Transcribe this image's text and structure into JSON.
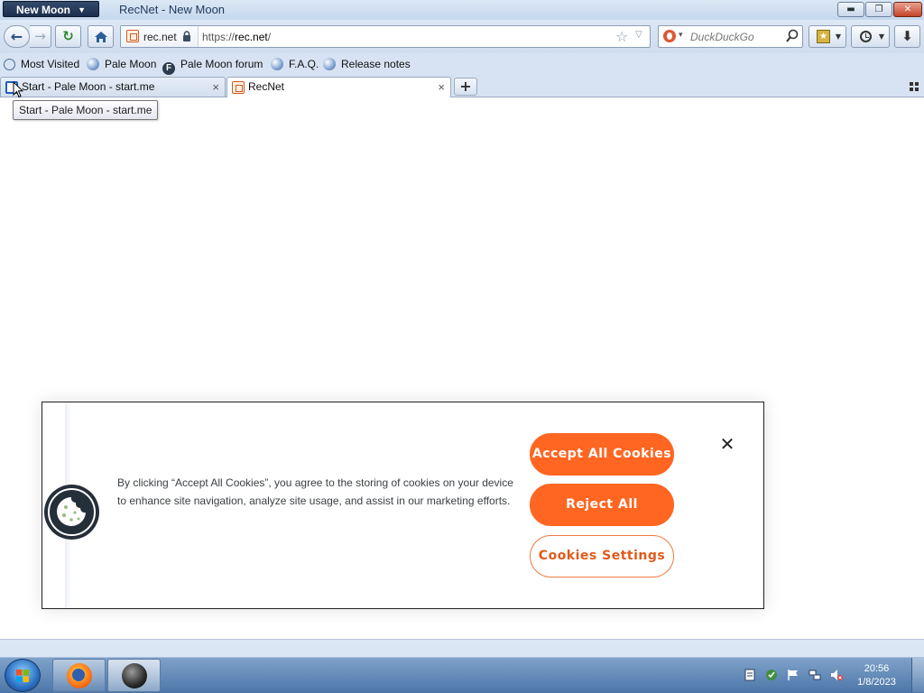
{
  "window": {
    "app_menu_label": "New Moon",
    "title": "RecNet - New Moon",
    "minimize_glyph": "▬",
    "maximize_glyph": "❐",
    "close_glyph": "✕"
  },
  "navbar": {
    "site_domain": "rec.net",
    "url_prefix": "https://",
    "url_host": "rec.net",
    "url_suffix": "/",
    "search_placeholder": "DuckDuckGo"
  },
  "bookmarks": {
    "items": [
      {
        "label": "Most Visited",
        "icon": "most-visited-icon"
      },
      {
        "label": "Pale Moon",
        "icon": "globe-icon"
      },
      {
        "label": "Pale Moon forum",
        "icon": "forum-f-icon"
      },
      {
        "label": "F.A.Q.",
        "icon": "globe-icon"
      },
      {
        "label": "Release notes",
        "icon": "globe-icon"
      }
    ],
    "forum_icon_letter": "F"
  },
  "tabs": [
    {
      "label": "Start - Pale Moon - start.me",
      "icon": "start-me-icon",
      "active": false
    },
    {
      "label": "RecNet",
      "icon": "recnet-icon",
      "active": true
    }
  ],
  "tab_close_glyph": "×",
  "new_tab_glyph": "+",
  "tooltip": "Start - Pale Moon - start.me",
  "cookie_banner": {
    "text": "By clicking “Accept All Cookies”, you agree to the storing of cookies on your device to enhance site navigation, analyze site usage, and assist in our marketing efforts.",
    "accept_label": "Accept All Cookies",
    "reject_label": "Reject All",
    "settings_label": "Cookies Settings",
    "close_glyph": "✕",
    "accent_color": "#ff6622"
  },
  "taskbar": {
    "time": "20:56",
    "date": "1/8/2023",
    "apps": [
      "firefox-icon",
      "pale-moon-icon"
    ]
  }
}
